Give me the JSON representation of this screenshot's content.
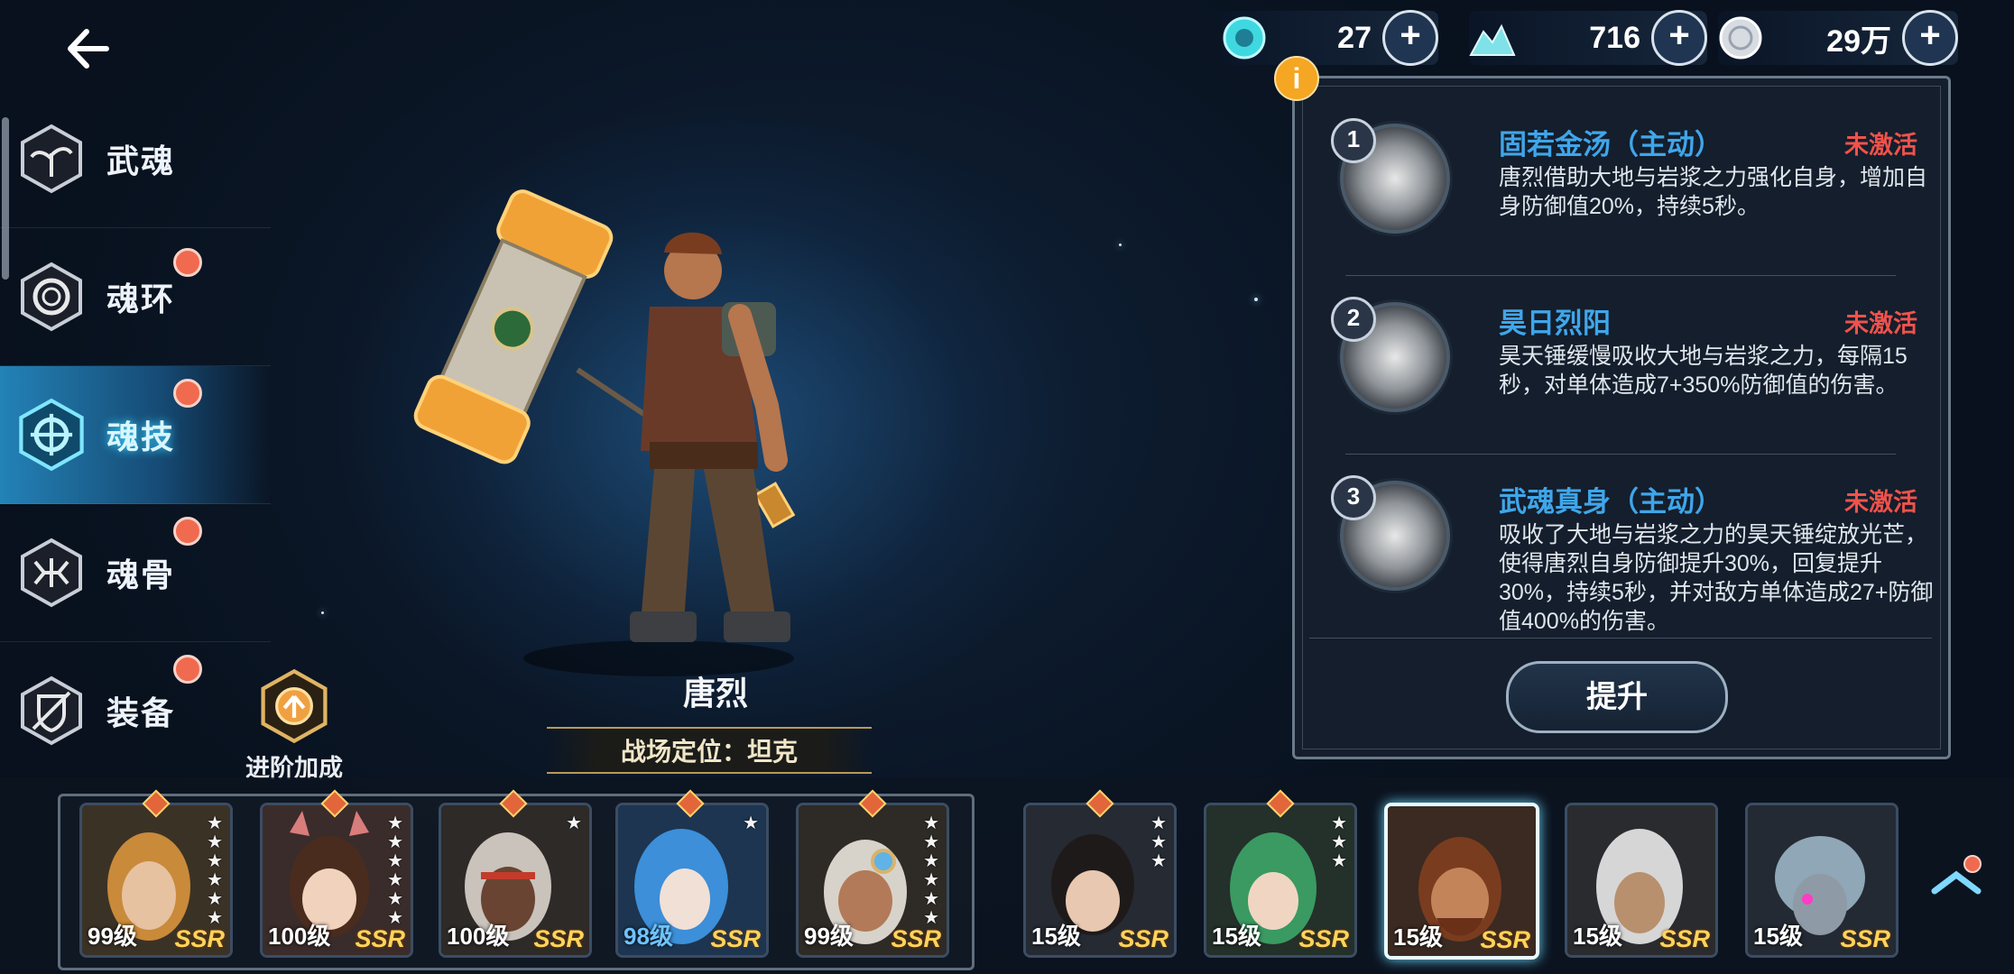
{
  "currencies": [
    {
      "icon": "soul-crystal-icon",
      "value": "27"
    },
    {
      "icon": "diamond-pile-icon",
      "value": "716"
    },
    {
      "icon": "silver-coin-icon",
      "value": "29万"
    }
  ],
  "nav": {
    "items": [
      {
        "label": "武魂",
        "icon": "plant-spirit-icon",
        "badge": false
      },
      {
        "label": "魂环",
        "icon": "soul-ring-icon",
        "badge": true
      },
      {
        "label": "魂技",
        "icon": "soul-skill-icon",
        "badge": true,
        "active": true
      },
      {
        "label": "魂骨",
        "icon": "soul-bone-icon",
        "badge": true
      },
      {
        "label": "装备",
        "icon": "equipment-icon",
        "badge": true
      }
    ]
  },
  "advance": {
    "label": "进阶加成"
  },
  "character": {
    "name": "唐烈",
    "role": "战场定位：坦克"
  },
  "skills": [
    {
      "num": "1",
      "name": "固若金汤（主动）",
      "status": "未激活",
      "desc": "唐烈借助大地与岩浆之力强化自身，增加自身防御值20%，持续5秒。"
    },
    {
      "num": "2",
      "name": "昊日烈阳",
      "status": "未激活",
      "desc": "昊天锤缓慢吸收大地与岩浆之力，每隔15秒，对单体造成7+350%防御值的伤害。"
    },
    {
      "num": "3",
      "name": "武魂真身（主动）",
      "status": "未激活",
      "desc": "吸收了大地与岩浆之力的昊天锤绽放光芒，使得唐烈自身防御提升30%，回复提升30%，持续5秒，并对敌方单体造成27+防御值400%的伤害。"
    }
  ],
  "upgrade_label": "提升",
  "info_badge": "i",
  "roster": {
    "team": [
      {
        "level": "99级",
        "rarity": "SSR",
        "stars": 6
      },
      {
        "level": "100级",
        "rarity": "SSR",
        "stars": 6
      },
      {
        "level": "100级",
        "rarity": "SSR",
        "stars": 1
      },
      {
        "level": "98级",
        "rarity": "SSR",
        "stars": 1
      },
      {
        "level": "99级",
        "rarity": "SSR",
        "stars": 6
      }
    ],
    "others": [
      {
        "level": "15级",
        "rarity": "SSR",
        "stars": 3
      },
      {
        "level": "15级",
        "rarity": "SSR",
        "stars": 3
      },
      {
        "level": "15级",
        "rarity": "SSR",
        "stars": 0,
        "selected": true
      },
      {
        "level": "15级",
        "rarity": "SSR",
        "stars": 0
      },
      {
        "level": "15级",
        "rarity": "SSR",
        "stars": 0
      }
    ]
  },
  "colors": {
    "accent": "#3fa6ea",
    "inactive": "#f0524b",
    "ssr": "#ffd45a",
    "badge": "#f06a4f"
  }
}
